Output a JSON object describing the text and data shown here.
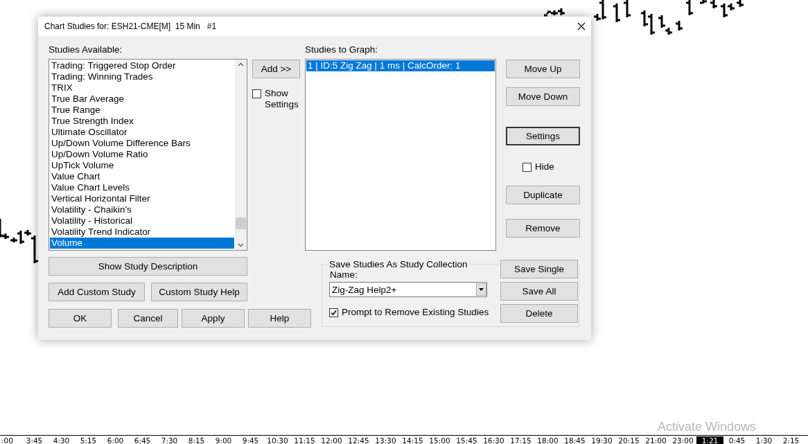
{
  "chart": {
    "time_axis": [
      {
        "label": ":00",
        "selected": false
      },
      {
        "label": "3:45",
        "selected": false
      },
      {
        "label": "4:30",
        "selected": false
      },
      {
        "label": "5:15",
        "selected": false
      },
      {
        "label": "6:00",
        "selected": false
      },
      {
        "label": "6:45",
        "selected": false
      },
      {
        "label": "7:30",
        "selected": false
      },
      {
        "label": "8:15",
        "selected": false
      },
      {
        "label": "9:00",
        "selected": false
      },
      {
        "label": "9:45",
        "selected": false
      },
      {
        "label": "10:30",
        "selected": false
      },
      {
        "label": "11:15",
        "selected": false
      },
      {
        "label": "12:00",
        "selected": false
      },
      {
        "label": "12:45",
        "selected": false
      },
      {
        "label": "13:30",
        "selected": false
      },
      {
        "label": "14:15",
        "selected": false
      },
      {
        "label": "15:00",
        "selected": false
      },
      {
        "label": "15:45",
        "selected": false
      },
      {
        "label": "16:30",
        "selected": false
      },
      {
        "label": "17:15",
        "selected": false
      },
      {
        "label": "18:00",
        "selected": false
      },
      {
        "label": "18:45",
        "selected": false
      },
      {
        "label": "19:30",
        "selected": false
      },
      {
        "label": "20:15",
        "selected": false
      },
      {
        "label": "21:00",
        "selected": false
      },
      {
        "label": "23:00",
        "selected": false
      },
      {
        "label": "1:21",
        "selected": true
      },
      {
        "label": "0:45",
        "selected": false
      },
      {
        "label": "1:30",
        "selected": false
      },
      {
        "label": "2:15",
        "selected": false
      }
    ],
    "notice": "Activate Windows"
  },
  "dialog": {
    "title": "Chart Studies for: ESH21-CME[M]  15 Min   #1",
    "available": {
      "label": "Studies Available:",
      "items": [
        {
          "label": "Trading: Triggered Stop Order",
          "selected": false
        },
        {
          "label": "Trading: Winning Trades",
          "selected": false
        },
        {
          "label": "TRIX",
          "selected": false
        },
        {
          "label": "True Bar Average",
          "selected": false
        },
        {
          "label": "True Range",
          "selected": false
        },
        {
          "label": "True Strength Index",
          "selected": false
        },
        {
          "label": "Ultimate Oscillator",
          "selected": false
        },
        {
          "label": "Up/Down Volume Difference Bars",
          "selected": false
        },
        {
          "label": "Up/Down Volume Ratio",
          "selected": false
        },
        {
          "label": "UpTick Volume",
          "selected": false
        },
        {
          "label": "Value Chart",
          "selected": false
        },
        {
          "label": "Value Chart Levels",
          "selected": false
        },
        {
          "label": "Vertical Horizontal Filter",
          "selected": false
        },
        {
          "label": "Volatility - Chaikin's",
          "selected": false
        },
        {
          "label": "Volatility - Historical",
          "selected": false
        },
        {
          "label": "Volatility Trend Indicator",
          "selected": false
        },
        {
          "label": "Volume",
          "selected": true
        }
      ]
    },
    "add_button": "Add >>",
    "show_settings": {
      "label": "Show Settings",
      "checked": false
    },
    "graph": {
      "label": "Studies to Graph:",
      "items": [
        {
          "label": "1 | ID:5  Zig Zag | 1 ms | CalcOrder: 1",
          "selected": true
        }
      ]
    },
    "side_buttons": [
      {
        "label": "Move Up",
        "default": false
      },
      {
        "label": "Move Down",
        "default": false
      },
      {
        "label": "Settings",
        "default": true
      }
    ],
    "hide": {
      "label": "Hide",
      "checked": false
    },
    "side_buttons_2": [
      "Duplicate",
      "Remove"
    ],
    "description_button": "Show Study Description",
    "custom_buttons": [
      "Add Custom Study",
      "Custom Study Help"
    ],
    "bottom_buttons": [
      "OK",
      "Cancel",
      "Apply",
      "Help"
    ],
    "collection": {
      "title": "Save Studies As Study Collection",
      "name_label": "Name:",
      "name_value": "Zig-Zag Help2+",
      "prompt": {
        "label": "Prompt to Remove Existing Studies",
        "checked": true
      },
      "buttons": [
        "Save Single",
        "Save All",
        "Delete"
      ]
    }
  }
}
